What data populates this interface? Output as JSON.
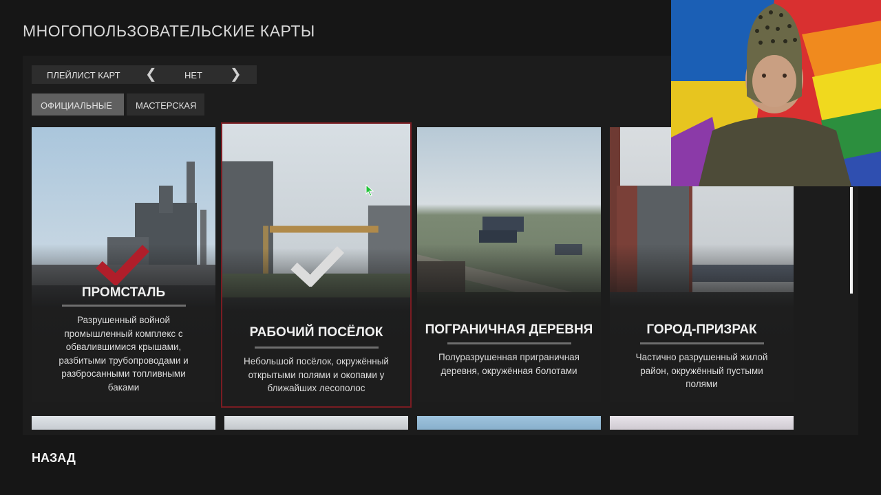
{
  "page": {
    "title": "МНОГОПОЛЬЗОВАТЕЛЬСКИЕ КАРТЫ"
  },
  "playlist": {
    "label": "ПЛЕЙЛИСТ КАРТ",
    "value": "НЕТ",
    "prev_icon": "chevron-left-icon",
    "next_icon": "chevron-right-icon"
  },
  "tabs": [
    {
      "label": "ОФИЦИАЛЬНЫЕ",
      "active": true
    },
    {
      "label": "МАСТЕРСКАЯ",
      "active": false
    }
  ],
  "maps": [
    {
      "name": "ПРОМСТАЛЬ",
      "description": "Разрушенный войной промышленный комплекс с обвалившимися крышами, разбитыми трубопроводами и разбросанными топливными баками",
      "checked": true,
      "check_color": "#b01e2a"
    },
    {
      "name": "РАБОЧИЙ ПОСЁЛОК",
      "description": "Небольшой посёлок, окружённый открытыми полями и окопами у ближайших лесополос",
      "checked": true,
      "check_color": "#dcdcdc",
      "selected": true
    },
    {
      "name": "ПОГРАНИЧНАЯ ДЕРЕВНЯ",
      "description": "Полуразрушенная приграничная деревня, окружённая болотами",
      "checked": false
    },
    {
      "name": "ГОРОД-ПРИЗРАК",
      "description": "Частично разрушенный жилой район, окружённый пустыми полями",
      "checked": false
    }
  ],
  "colors": {
    "background": "#161616",
    "panel": "#1c1c1c",
    "selected_border": "#7a1c22",
    "tab_active": "#606060"
  },
  "footer": {
    "back_label": "НАЗАД"
  }
}
